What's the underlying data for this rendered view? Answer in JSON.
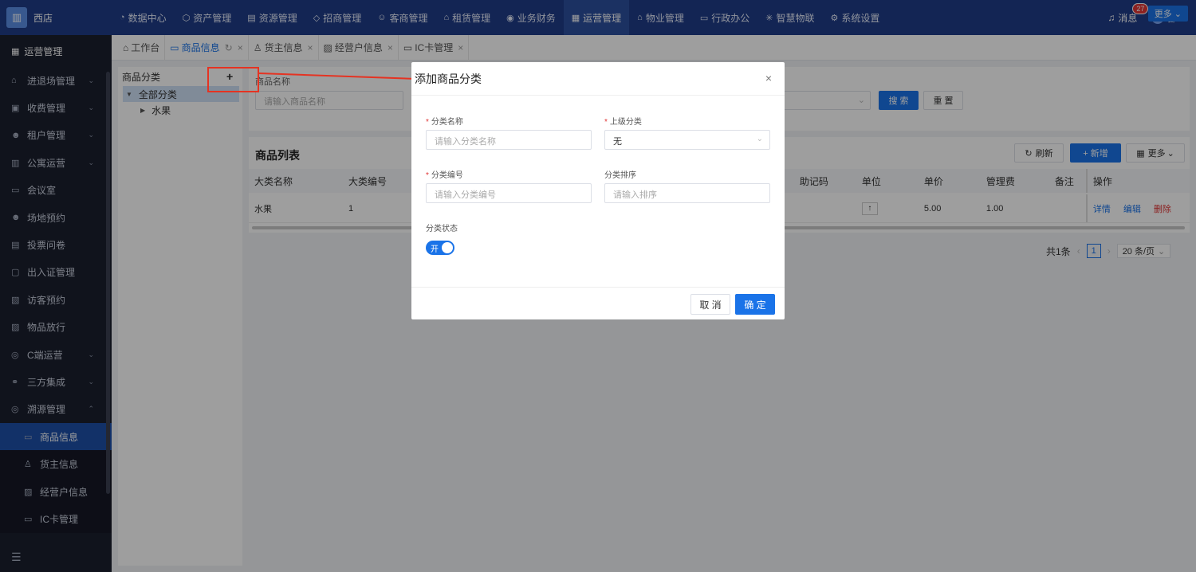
{
  "app": {
    "logo_icon": "building-icon",
    "logo_text": "西店"
  },
  "topnav": {
    "items": [
      {
        "label": "数据中心",
        "icon": "◔"
      },
      {
        "label": "资产管理",
        "icon": "⬡"
      },
      {
        "label": "资源管理",
        "icon": "▤"
      },
      {
        "label": "招商管理",
        "icon": "◇"
      },
      {
        "label": "客商管理",
        "icon": "☺"
      },
      {
        "label": "租赁管理",
        "icon": "⌂"
      },
      {
        "label": "业务财务",
        "icon": "◉"
      },
      {
        "label": "运营管理",
        "icon": "▦"
      },
      {
        "label": "物业管理",
        "icon": "⌂"
      },
      {
        "label": "行政办公",
        "icon": "▭"
      },
      {
        "label": "智慧物联",
        "icon": "✳"
      },
      {
        "label": "系统设置",
        "icon": "⚙"
      }
    ],
    "active_index": 7,
    "message_label": "消息",
    "message_count": "27",
    "user_name": "邵"
  },
  "sidebar": {
    "title": "运营管理",
    "items": [
      {
        "label": "进退场管理",
        "icon": "⌂",
        "arrow": "⌄"
      },
      {
        "label": "收费管理",
        "icon": "▣",
        "arrow": "⌄"
      },
      {
        "label": "租户管理",
        "icon": "☻",
        "arrow": "⌄"
      },
      {
        "label": "公寓运营",
        "icon": "▥",
        "arrow": "⌄"
      },
      {
        "label": "会议室",
        "icon": "▭",
        "arrow": ""
      },
      {
        "label": "场地预约",
        "icon": "☻",
        "arrow": ""
      },
      {
        "label": "投票问卷",
        "icon": "▤",
        "arrow": ""
      },
      {
        "label": "出入证管理",
        "icon": "▢",
        "arrow": ""
      },
      {
        "label": "访客预约",
        "icon": "▧",
        "arrow": ""
      },
      {
        "label": "物品放行",
        "icon": "▨",
        "arrow": ""
      },
      {
        "label": "C端运营",
        "icon": "◎",
        "arrow": "⌄"
      },
      {
        "label": "三方集成",
        "icon": "⚭",
        "arrow": "⌄"
      },
      {
        "label": "溯源管理",
        "icon": "◎",
        "arrow": "⌃"
      }
    ],
    "sub_items": [
      {
        "label": "商品信息",
        "icon": "▭",
        "active": true
      },
      {
        "label": "货主信息",
        "icon": "♙",
        "active": false
      },
      {
        "label": "经营户信息",
        "icon": "▨",
        "active": false
      },
      {
        "label": "IC卡管理",
        "icon": "▭",
        "active": false
      }
    ]
  },
  "tabs": [
    {
      "label": "工作台",
      "icon": "⌂",
      "closable": false
    },
    {
      "label": "商品信息",
      "icon": "▭",
      "closable": true,
      "active": true
    },
    {
      "label": "货主信息",
      "icon": "♙",
      "closable": true
    },
    {
      "label": "经营户信息",
      "icon": "▨",
      "closable": true
    },
    {
      "label": "IC卡管理",
      "icon": "▭",
      "closable": true
    }
  ],
  "tabs_more": "更多 ⌄",
  "tree": {
    "title": "商品分类",
    "add": "+",
    "root": "全部分类",
    "children": [
      "水果"
    ]
  },
  "search": {
    "label": "商品名称",
    "placeholder": "请输入商品名称",
    "select2_placeholder": "",
    "search_btn": "搜 索",
    "reset_btn": "重 置"
  },
  "list": {
    "title": "商品列表",
    "refresh": "刷新",
    "add": "+ 新增",
    "more": "更多",
    "columns": [
      "大类名称",
      "大类编号",
      "",
      "",
      "",
      "",
      "",
      "",
      "",
      "助记码",
      "单位",
      "单价",
      "管理费",
      "备注",
      "操作"
    ],
    "rows": [
      {
        "cells": [
          "水果",
          "1",
          "",
          "",
          "",
          "",
          "",
          "",
          "",
          "",
          "↑",
          "5.00",
          "1.00",
          "",
          ""
        ],
        "ops": [
          "详情",
          "编辑",
          "删除"
        ]
      }
    ],
    "total": "共1条",
    "page": "1",
    "page_size": "20 条/页"
  },
  "modal": {
    "title": "添加商品分类",
    "close": "×",
    "fields": {
      "name_label": "分类名称",
      "name_placeholder": "请输入分类名称",
      "parent_label": "上级分类",
      "parent_value": "无",
      "code_label": "分类编号",
      "code_placeholder": "请输入分类编号",
      "sort_label": "分类排序",
      "sort_placeholder": "请输入排序",
      "status_label": "分类状态",
      "status_value": "开"
    },
    "cancel": "取 消",
    "ok": "确 定"
  },
  "colors": {
    "primary": "#1a73e8",
    "topbar": "#1f3c88",
    "sidebar": "#1b1f2e",
    "annotation": "#e53322"
  }
}
